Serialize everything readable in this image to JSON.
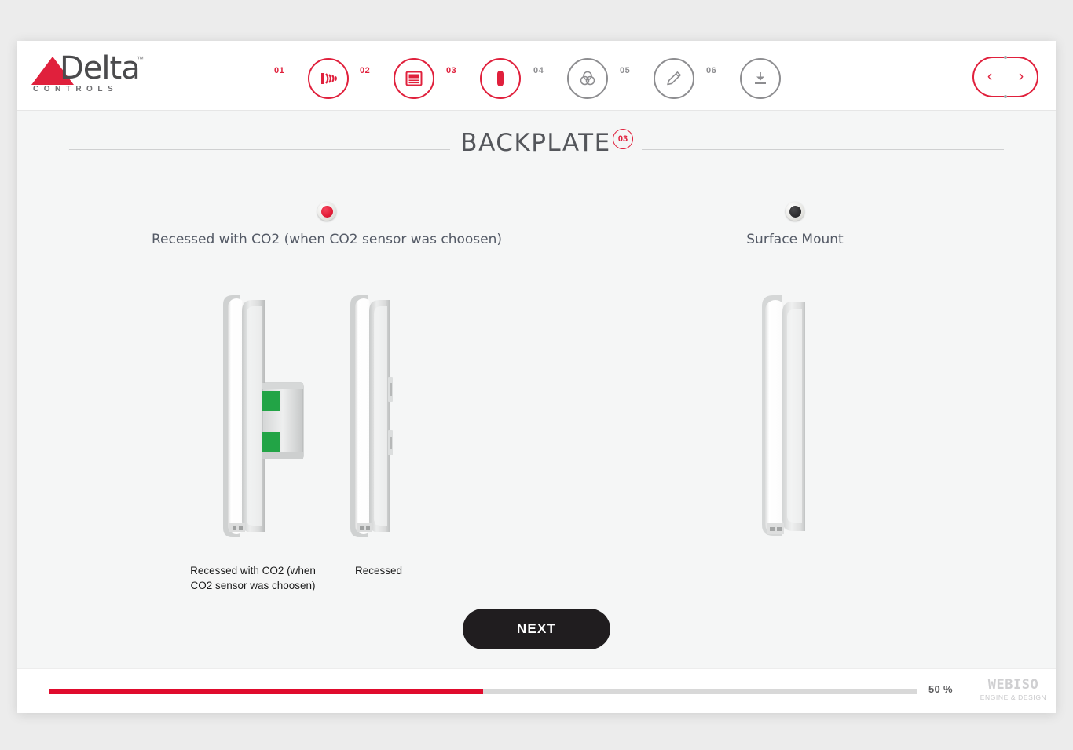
{
  "brand": {
    "name": "Delta",
    "tagline": "CONTROLS",
    "trademark": "™",
    "accent": "#e0203c"
  },
  "stepper": {
    "steps": [
      {
        "num": "01",
        "icon": "motion-sensor-icon",
        "active": true
      },
      {
        "num": "02",
        "icon": "display-keypad-icon",
        "active": true
      },
      {
        "num": "03",
        "icon": "backplate-icon",
        "active": true
      },
      {
        "num": "04",
        "icon": "color-venn-icon",
        "active": false
      },
      {
        "num": "05",
        "icon": "pencil-icon",
        "active": false
      },
      {
        "num": "06",
        "icon": "download-icon",
        "active": false
      }
    ]
  },
  "nav": {
    "prev_label": "‹",
    "next_label": "›"
  },
  "page": {
    "title": "BACKPLATE",
    "badge": "03"
  },
  "options": [
    {
      "label": "Recessed with CO2 (when CO2 sensor was choosen)",
      "selected": true
    },
    {
      "label": "Surface Mount",
      "selected": false
    }
  ],
  "figures": [
    {
      "caption": "Recessed with CO2 (when CO2 sensor was choosen)"
    },
    {
      "caption": "Recessed"
    }
  ],
  "actions": {
    "next_label": "NEXT"
  },
  "footer": {
    "progress_percent": 50,
    "progress_label": "50 %",
    "watermark_name": "WEBISO",
    "watermark_tagline": "ENGINE & DESIGN"
  }
}
